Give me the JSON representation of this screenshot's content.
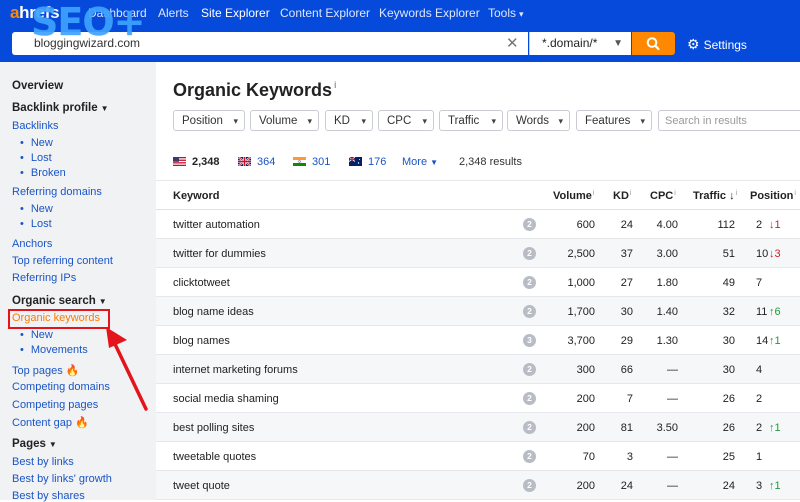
{
  "brand": {
    "logo_a": "a",
    "logo_rest": "hrefs",
    "badge": "SEO+"
  },
  "nav": {
    "items": [
      {
        "label": "Dashboard"
      },
      {
        "label": "Alerts"
      },
      {
        "label": "Site Explorer"
      },
      {
        "label": "Content Explorer"
      },
      {
        "label": "Keywords Explorer"
      },
      {
        "label": "Tools"
      }
    ]
  },
  "search": {
    "url_value": "bloggingwizard.com",
    "mode": "*.domain/*",
    "settings_label": "Settings"
  },
  "sidebar": {
    "overview": "Overview",
    "backlink_profile": "Backlink profile",
    "backlinks": "Backlinks",
    "backlinks_sub": [
      "New",
      "Lost",
      "Broken"
    ],
    "referring_domains": "Referring domains",
    "referring_domains_sub": [
      "New",
      "Lost"
    ],
    "anchors": "Anchors",
    "top_referring_content": "Top referring content",
    "referring_ips": "Referring IPs",
    "organic_search": "Organic search",
    "organic_keywords": "Organic keywords",
    "organic_sub": [
      "New",
      "Movements"
    ],
    "top_pages": "Top pages",
    "competing_domains": "Competing domains",
    "competing_pages": "Competing pages",
    "content_gap": "Content gap",
    "pages": "Pages",
    "best_by_links": "Best by links",
    "best_by_links_growth": "Best by links' growth",
    "best_by_shares": "Best by shares"
  },
  "page": {
    "title": "Organic Keywords",
    "info": "i"
  },
  "filters": {
    "items": [
      {
        "label": "Position"
      },
      {
        "label": "Volume"
      },
      {
        "label": "KD"
      },
      {
        "label": "CPC"
      },
      {
        "label": "Traffic"
      },
      {
        "label": "Words"
      },
      {
        "label": "Features"
      }
    ],
    "search_placeholder": "Search in results"
  },
  "countries": {
    "items": [
      {
        "count": "2,348",
        "flag": "us"
      },
      {
        "count": "364",
        "flag": "uk"
      },
      {
        "count": "301",
        "flag": "in"
      },
      {
        "count": "176",
        "flag": "au"
      }
    ],
    "more": "More",
    "results": "2,348 results"
  },
  "table": {
    "headers": {
      "keyword": "Keyword",
      "volume": "Volume",
      "kd": "KD",
      "cpc": "CPC",
      "traffic": "Traffic",
      "position": "Position"
    },
    "rows": [
      {
        "keyword": "twitter automation",
        "serp": "2",
        "volume": "600",
        "kd": "24",
        "cpc": "4.00",
        "traffic": "112",
        "position": "2",
        "change": "1",
        "dir": "down"
      },
      {
        "keyword": "twitter for dummies",
        "serp": "2",
        "volume": "2,500",
        "kd": "37",
        "cpc": "3.00",
        "traffic": "51",
        "position": "10",
        "change": "3",
        "dir": "down"
      },
      {
        "keyword": "clicktotweet",
        "serp": "2",
        "volume": "1,000",
        "kd": "27",
        "cpc": "1.80",
        "traffic": "49",
        "position": "7",
        "change": "",
        "dir": ""
      },
      {
        "keyword": "blog name ideas",
        "serp": "2",
        "volume": "1,700",
        "kd": "30",
        "cpc": "1.40",
        "traffic": "32",
        "position": "11",
        "change": "6",
        "dir": "up"
      },
      {
        "keyword": "blog names",
        "serp": "3",
        "volume": "3,700",
        "kd": "29",
        "cpc": "1.30",
        "traffic": "30",
        "position": "14",
        "change": "1",
        "dir": "up"
      },
      {
        "keyword": "internet marketing forums",
        "serp": "2",
        "volume": "300",
        "kd": "66",
        "cpc": "—",
        "traffic": "30",
        "position": "4",
        "change": "",
        "dir": ""
      },
      {
        "keyword": "social media shaming",
        "serp": "2",
        "volume": "200",
        "kd": "7",
        "cpc": "—",
        "traffic": "26",
        "position": "2",
        "change": "",
        "dir": ""
      },
      {
        "keyword": "best polling sites",
        "serp": "2",
        "volume": "200",
        "kd": "81",
        "cpc": "3.50",
        "traffic": "26",
        "position": "2",
        "change": "1",
        "dir": "up"
      },
      {
        "keyword": "tweetable quotes",
        "serp": "2",
        "volume": "70",
        "kd": "3",
        "cpc": "—",
        "traffic": "25",
        "position": "1",
        "change": "",
        "dir": ""
      },
      {
        "keyword": "tweet quote",
        "serp": "2",
        "volume": "200",
        "kd": "24",
        "cpc": "—",
        "traffic": "24",
        "position": "3",
        "change": "1",
        "dir": "up"
      }
    ]
  },
  "colors": {
    "nav_blue": "#054ada",
    "accent_orange": "#ff8800",
    "link_blue": "#1a55c7",
    "highlight_red": "#e3141b"
  }
}
